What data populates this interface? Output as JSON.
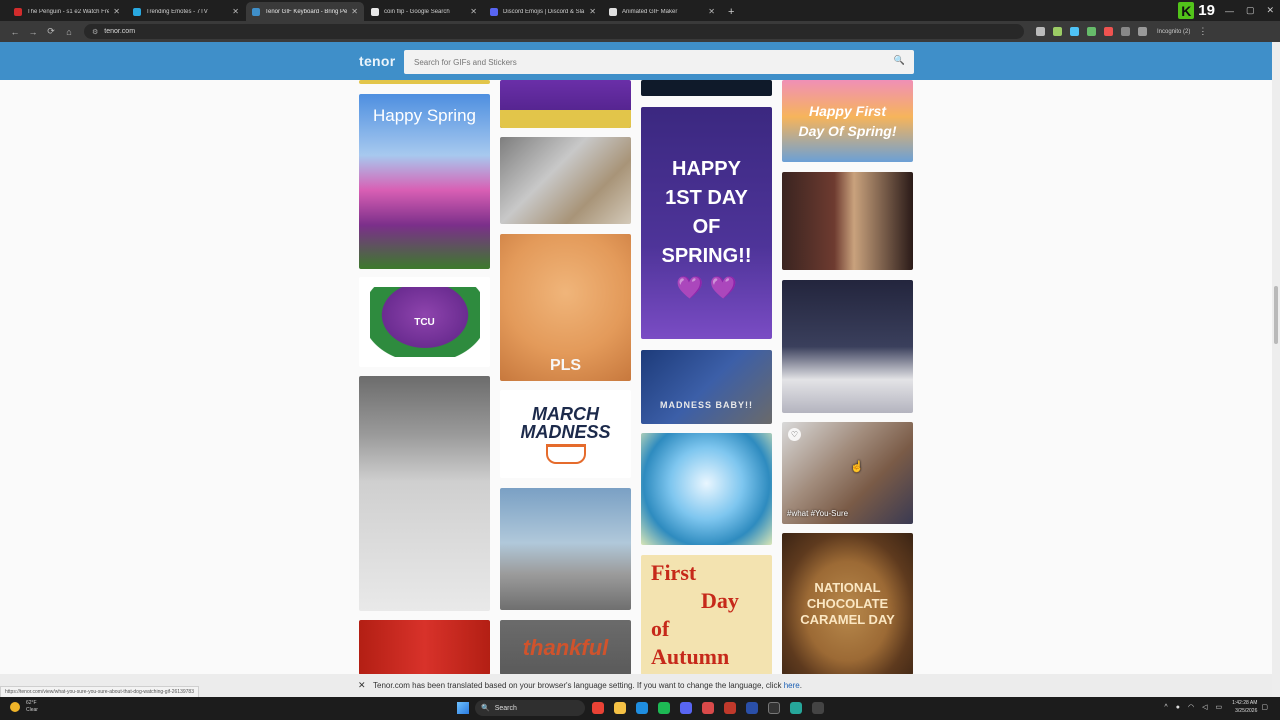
{
  "browser": {
    "tabs": [
      {
        "title": "The Penguin - s1 e2 Watch Fre",
        "color": "#d22c2c",
        "active": false
      },
      {
        "title": "Trending Emotes - 7TV",
        "color": "#29a8e0",
        "active": false
      },
      {
        "title": "Tenor GIF Keyboard - Bring Per",
        "color": "#3f8fc9",
        "active": true
      },
      {
        "title": "coin flip - Google Search",
        "color": "#e8e8e8",
        "active": false
      },
      {
        "title": "Discord Emojis | Discord & Sla",
        "color": "#5865f2",
        "active": false
      },
      {
        "title": "Animated GIF Maker",
        "color": "#e0e0e0",
        "active": false
      }
    ],
    "new_tab": "+",
    "k_badge": "K",
    "k_number": "19",
    "address": "tenor.com",
    "incognito": "Incognito (2)",
    "nav": {
      "back": "←",
      "forward": "→",
      "reload": "⟳",
      "home": "⌂"
    }
  },
  "tenor": {
    "logo": "tenor",
    "search_placeholder": "Search for GIFs and Stickers",
    "search_icon": "search-icon"
  },
  "tiles": {
    "happy_spring": "Happy Spring",
    "frog_label": "TCU",
    "pls": "PLS",
    "march_line1": "MARCH",
    "march_line2": "MADNESS",
    "thankful": "thankful",
    "first_spring": [
      "HAPPY",
      "1ST DAY",
      "OF",
      "SPRING!!"
    ],
    "first_spring_hearts": "💜 💜",
    "madness": "MADNESS BABY!!",
    "autumn": [
      "First",
      "Day",
      "of",
      "Autumn"
    ],
    "happy_first_day": [
      "Happy First",
      "Day Of Spring!"
    ],
    "dog_tags": "#what  #You-Sure",
    "choc": [
      "NATIONAL",
      "CHOCOLATE",
      "CARAMEL DAY"
    ]
  },
  "translate_bar": {
    "message": "Tenor.com has been translated based on your browser's language setting. If you want to change the language, click",
    "link": "here",
    "end": "."
  },
  "status_url": "https://tenor.com/view/what-you-sure-you-sure-about-that-dog-watching-gif-26139783",
  "taskbar": {
    "temp": "62°F",
    "condition": "Clear",
    "search": "Search",
    "time": "1:42:28 AM",
    "date": "3/25/2026"
  }
}
